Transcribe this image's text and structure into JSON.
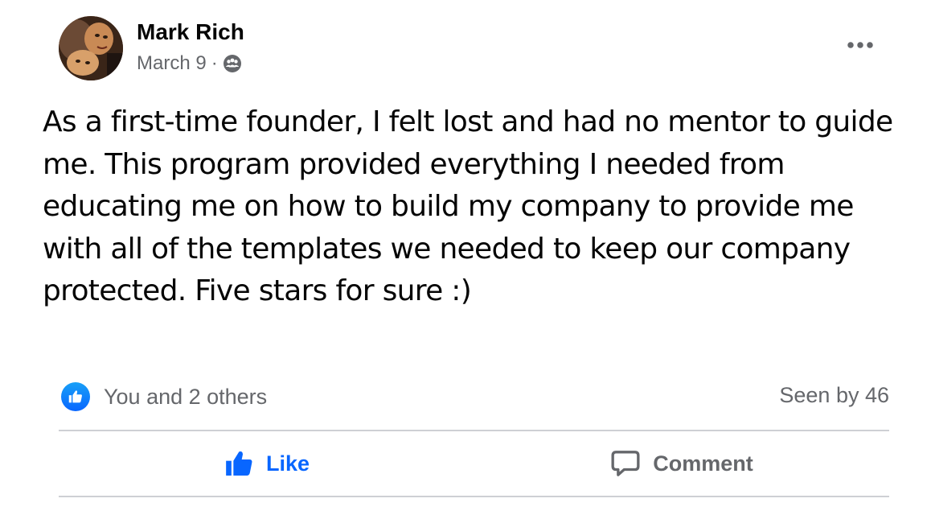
{
  "post": {
    "author": "Mark Rich",
    "date": "March 9",
    "separator": "·",
    "audience_icon": "friends-icon",
    "more_icon": "more-horizontal-icon",
    "text": "As a first-time founder, I felt lost and had no mentor to guide\nme. This program provided everything I needed from\neducating me on how to build my company to provide me\nwith all of the templates we needed to keep our company\nprotected. Five stars for sure :)"
  },
  "engagement": {
    "reaction_icon": "like-reaction-icon",
    "reaction_summary": "You and 2 others",
    "seen_by": "Seen by 46"
  },
  "actions": {
    "like_label": "Like",
    "like_icon": "thumbs-up-icon",
    "comment_label": "Comment",
    "comment_icon": "comment-icon"
  },
  "colors": {
    "accent": "#0866ff",
    "secondary_text": "#65676b",
    "primary_text": "#050505",
    "divider": "#ced0d4"
  }
}
